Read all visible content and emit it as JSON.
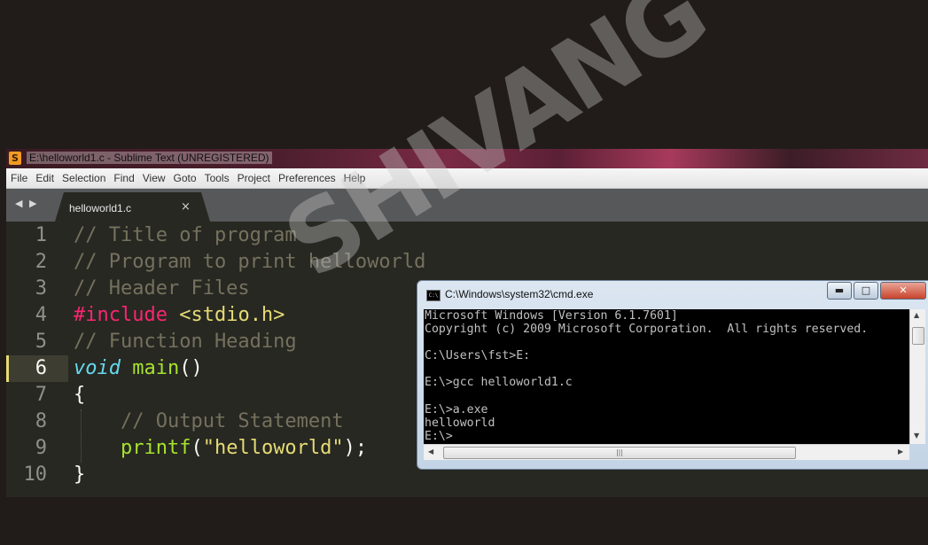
{
  "editor": {
    "window_title": "E:\\helloworld1.c - Sublime Text (UNREGISTERED)",
    "app_icon_glyph": "S",
    "menu": [
      "File",
      "Edit",
      "Selection",
      "Find",
      "View",
      "Goto",
      "Tools",
      "Project",
      "Preferences",
      "Help"
    ],
    "nav_arrows": "◀ ▶",
    "tab": {
      "label": "helloworld1.c",
      "close": "×"
    },
    "line_numbers": [
      "1",
      "2",
      "3",
      "4",
      "5",
      "6",
      "7",
      "8",
      "9",
      "10"
    ],
    "active_line": "6",
    "code": {
      "l1": "// Title of program",
      "l2": "// Program to print helloworld",
      "l3": "// Header Files",
      "l4_kw": "#include",
      "l4_inc": "<stdio.h>",
      "l5": "// Function Heading",
      "l6_type": "void",
      "l6_fn": "main",
      "l6_paren": "()",
      "l7": "{",
      "l8": "// Output Statement",
      "l9_fn": "printf",
      "l9_open": "(",
      "l9_str": "\"helloworld\"",
      "l9_close": ");",
      "l10": "}"
    },
    "colors": {
      "background": "#272822",
      "comment": "#75715e",
      "keyword": "#f92672",
      "string": "#e6db74",
      "type": "#66d9ef",
      "function": "#a6e22e"
    }
  },
  "watermark": "SHIVANG",
  "cmd": {
    "title": "C:\\Windows\\system32\\cmd.exe",
    "icon_glyph": "C:\\",
    "buttons": {
      "minimize": "▬",
      "maximize": "□",
      "close": "✕"
    },
    "console_text": "Microsoft Windows [Version 6.1.7601]\nCopyright (c) 2009 Microsoft Corporation.  All rights reserved.\n\nC:\\Users\\fst>E:\n\nE:\\>gcc helloworld1.c\n\nE:\\>a.exe\nhelloworld\nE:\\>",
    "scroll": {
      "up": "▲",
      "down": "▼",
      "left": "◀",
      "right": "▶",
      "grip": "|||"
    }
  }
}
